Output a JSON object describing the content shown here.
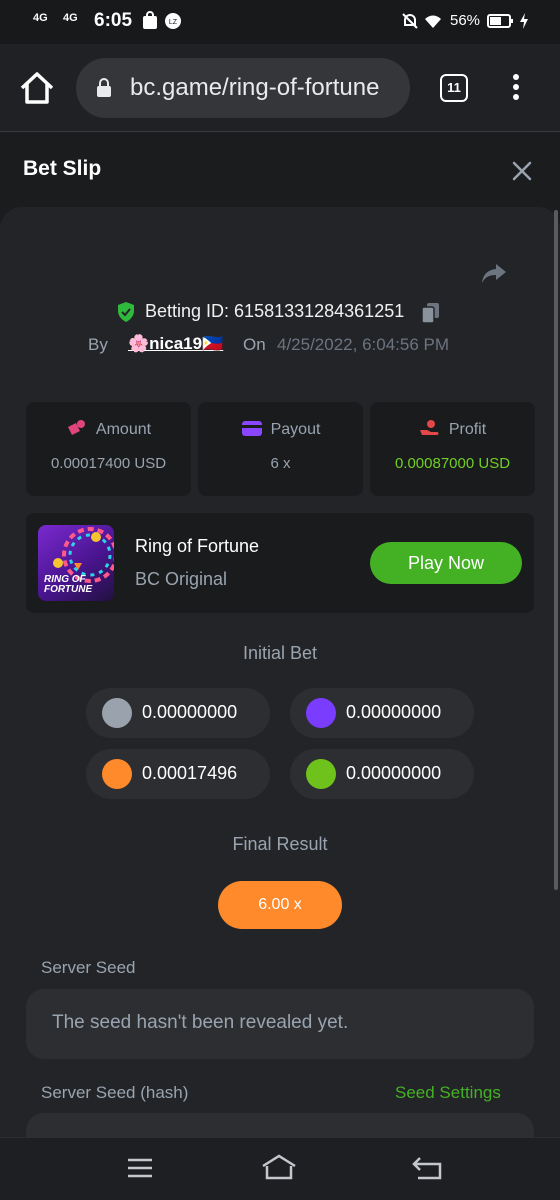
{
  "status_bar": {
    "signal_1": "4G",
    "signal_2": "4G",
    "time": "6:05",
    "battery": "56%"
  },
  "browser": {
    "url": "bc.game/ring-of-fortune",
    "tab_count": "11"
  },
  "header": {
    "title": "Bet Slip"
  },
  "bet": {
    "id_text": "Betting ID: 61581331284361251",
    "by_label": "By",
    "user": "🌸nica19🇵🇭",
    "on_label": "On",
    "date": "4/25/2022, 6:04:56 PM"
  },
  "stats": {
    "amount_label": "Amount",
    "amount_value": "0.00017400 USD",
    "payout_label": "Payout",
    "payout_value": "6 x",
    "profit_label": "Profit",
    "profit_value": "0.00087000 USD"
  },
  "game": {
    "thumb_line1": "RING OF",
    "thumb_line2": "FORTUNE",
    "name": "Ring of Fortune",
    "subtitle": "BC Original",
    "play_label": "Play Now"
  },
  "initial_bet": {
    "title": "Initial Bet",
    "coins": [
      {
        "color": "#9aa3ad",
        "value": "0.00000000"
      },
      {
        "color": "#7a3cff",
        "value": "0.00000000"
      },
      {
        "color": "#ff8a2c",
        "value": "0.00017496"
      },
      {
        "color": "#6fc21c",
        "value": "0.00000000"
      }
    ]
  },
  "final_result": {
    "title": "Final Result",
    "value": "6.00 x"
  },
  "seeds": {
    "server_seed_label": "Server Seed",
    "server_seed_value": "The seed hasn't been revealed yet.",
    "server_seed_hash_label": "Server Seed (hash)",
    "seed_settings_label": "Seed Settings"
  },
  "colors": {
    "accent_green": "#44b124",
    "profit_green": "#6fcf24",
    "result_orange": "#ff8a2c",
    "shield_green": "#2fba3c"
  }
}
